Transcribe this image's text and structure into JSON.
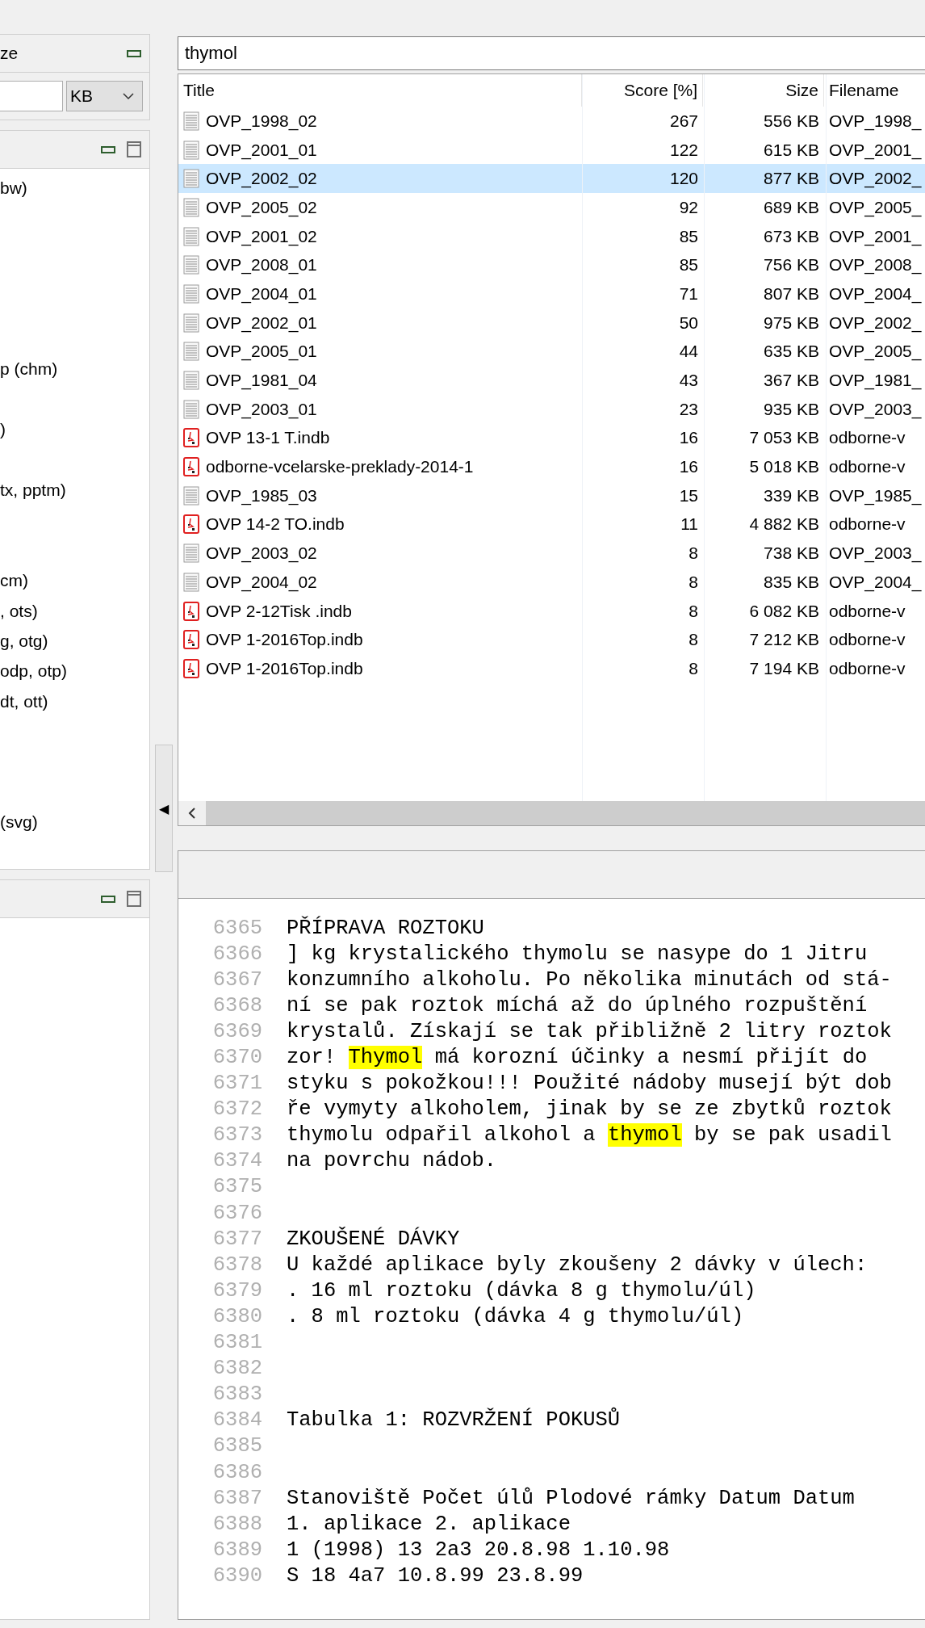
{
  "left_panels": [
    {
      "title": "ze",
      "controls": [
        {
          "kind": "minimize"
        }
      ],
      "size_filter": {
        "unit": "KB"
      }
    },
    {
      "controls": [
        {
          "kind": "minimize"
        },
        {
          "kind": "maximize"
        }
      ],
      "items": [
        {
          "text": "bw)"
        },
        {
          "text": "p (chm)"
        },
        {
          "text": ")"
        },
        {
          "text": "tx, pptm)"
        },
        {
          "text": "cm)"
        },
        {
          "text": ", ots)"
        },
        {
          "text": "g, otg)"
        },
        {
          "text": "odp, otp)"
        },
        {
          "text": "dt, ott)"
        },
        {
          "text": "(svg)"
        }
      ]
    },
    {
      "controls": [
        {
          "kind": "minimize"
        },
        {
          "kind": "maximize"
        }
      ]
    }
  ],
  "splitter": {
    "arrow": "◀"
  },
  "search": {
    "value": "thymol"
  },
  "results": {
    "columns": [
      "Title",
      "Score [%]",
      "Size",
      "Filename"
    ],
    "rows": [
      {
        "kind": "text",
        "title": "OVP_1998_02",
        "score": "267",
        "size": "556 KB",
        "filename": "OVP_1998_",
        "selected": false
      },
      {
        "kind": "text",
        "title": "OVP_2001_01",
        "score": "122",
        "size": "615 KB",
        "filename": "OVP_2001_",
        "selected": false
      },
      {
        "kind": "text",
        "title": "OVP_2002_02",
        "score": "120",
        "size": "877 KB",
        "filename": "OVP_2002_",
        "selected": true
      },
      {
        "kind": "text",
        "title": "OVP_2005_02",
        "score": "92",
        "size": "689 KB",
        "filename": "OVP_2005_",
        "selected": false
      },
      {
        "kind": "text",
        "title": "OVP_2001_02",
        "score": "85",
        "size": "673 KB",
        "filename": "OVP_2001_",
        "selected": false
      },
      {
        "kind": "text",
        "title": "OVP_2008_01",
        "score": "85",
        "size": "756 KB",
        "filename": "OVP_2008_",
        "selected": false
      },
      {
        "kind": "text",
        "title": "OVP_2004_01",
        "score": "71",
        "size": "807 KB",
        "filename": "OVP_2004_",
        "selected": false
      },
      {
        "kind": "text",
        "title": "OVP_2002_01",
        "score": "50",
        "size": "975 KB",
        "filename": "OVP_2002_",
        "selected": false
      },
      {
        "kind": "text",
        "title": "OVP_2005_01",
        "score": "44",
        "size": "635 KB",
        "filename": "OVP_2005_",
        "selected": false
      },
      {
        "kind": "text",
        "title": "OVP_1981_04",
        "score": "43",
        "size": "367 KB",
        "filename": "OVP_1981_",
        "selected": false
      },
      {
        "kind": "text",
        "title": "OVP_2003_01",
        "score": "23",
        "size": "935 KB",
        "filename": "OVP_2003_",
        "selected": false
      },
      {
        "kind": "pdf",
        "title": "OVP 13-1 T.indb",
        "score": "16",
        "size": "7 053 KB",
        "filename": "odborne-v",
        "selected": false
      },
      {
        "kind": "pdf",
        "title": "odborne-vcelarske-preklady-2014-1",
        "score": "16",
        "size": "5 018 KB",
        "filename": "odborne-v",
        "selected": false
      },
      {
        "kind": "text",
        "title": "OVP_1985_03",
        "score": "15",
        "size": "339 KB",
        "filename": "OVP_1985_",
        "selected": false
      },
      {
        "kind": "pdf",
        "title": "OVP 14-2 TO.indb",
        "score": "11",
        "size": "4 882 KB",
        "filename": "odborne-v",
        "selected": false
      },
      {
        "kind": "text",
        "title": "OVP_2003_02",
        "score": "8",
        "size": "738 KB",
        "filename": "OVP_2003_",
        "selected": false
      },
      {
        "kind": "text",
        "title": "OVP_2004_02",
        "score": "8",
        "size": "835 KB",
        "filename": "OVP_2004_",
        "selected": false
      },
      {
        "kind": "pdf",
        "title": "OVP 2-12Tisk .indb",
        "score": "8",
        "size": "6 082 KB",
        "filename": "odborne-v",
        "selected": false
      },
      {
        "kind": "pdf",
        "title": "OVP 1-2016Top.indb",
        "score": "8",
        "size": "7 212 KB",
        "filename": "odborne-v",
        "selected": false
      },
      {
        "kind": "pdf",
        "title": "OVP 1-2016Top.indb",
        "score": "8",
        "size": "7 194 KB",
        "filename": "odborne-v",
        "selected": false
      }
    ]
  },
  "preview": {
    "lines": [
      {
        "number": "6365",
        "parts": [
          {
            "text": "PŘÍPRAVA ROZTOKU",
            "highlighted": false
          }
        ]
      },
      {
        "number": "6366",
        "parts": [
          {
            "text": "] kg krystalického thymolu se nasype do 1 Jitru",
            "highlighted": false
          }
        ]
      },
      {
        "number": "6367",
        "parts": [
          {
            "text": "konzumního alkoholu. Po několika minutách od stá-",
            "highlighted": false
          }
        ]
      },
      {
        "number": "6368",
        "parts": [
          {
            "text": "ní se pak roztok míchá až do úplného rozpuštění",
            "highlighted": false
          }
        ]
      },
      {
        "number": "6369",
        "parts": [
          {
            "text": "krystalů. Získají se tak přibližně 2 litry roztok",
            "highlighted": false
          }
        ]
      },
      {
        "number": "6370",
        "parts": [
          {
            "text": "zor! ",
            "highlighted": false
          },
          {
            "text": "Thymol",
            "highlighted": true
          },
          {
            "text": " má korozní účinky a nesmí přijít do",
            "highlighted": false
          }
        ]
      },
      {
        "number": "6371",
        "parts": [
          {
            "text": "styku s pokožkou!!! Použité nádoby musejí být dob",
            "highlighted": false
          }
        ]
      },
      {
        "number": "6372",
        "parts": [
          {
            "text": "ře vymyty alkoholem, jinak by se ze zbytků roztok",
            "highlighted": false
          }
        ]
      },
      {
        "number": "6373",
        "parts": [
          {
            "text": "thymolu odpařil alkohol a ",
            "highlighted": false
          },
          {
            "text": "thymol",
            "highlighted": true
          },
          {
            "text": " by se pak usadil",
            "highlighted": false
          }
        ]
      },
      {
        "number": "6374",
        "parts": [
          {
            "text": "na povrchu nádob.",
            "highlighted": false
          }
        ]
      },
      {
        "number": "6375"
      },
      {
        "number": "6376"
      },
      {
        "number": "6377",
        "parts": [
          {
            "text": "ZKOUŠENÉ DÁVKY",
            "highlighted": false
          }
        ]
      },
      {
        "number": "6378",
        "parts": [
          {
            "text": "U každé aplikace byly zkoušeny 2 dávky v úlech:",
            "highlighted": false
          }
        ]
      },
      {
        "number": "6379",
        "parts": [
          {
            "text": ". 16 ml roztoku (dávka 8 g thymolu/úl)",
            "highlighted": false
          }
        ]
      },
      {
        "number": "6380",
        "parts": [
          {
            "text": ". 8 ml roztoku (dávka 4 g thymolu/úl)",
            "highlighted": false
          }
        ]
      },
      {
        "number": "6381"
      },
      {
        "number": "6382"
      },
      {
        "number": "6383"
      },
      {
        "number": "6384",
        "parts": [
          {
            "text": "Tabulka 1: ROZVRŽENÍ POKUSŮ",
            "highlighted": false
          }
        ]
      },
      {
        "number": "6385"
      },
      {
        "number": "6386"
      },
      {
        "number": "6387",
        "parts": [
          {
            "text": "Stanoviště Počet úlů Plodové rámky Datum Datum",
            "highlighted": false
          }
        ]
      },
      {
        "number": "6388",
        "parts": [
          {
            "text": "1. aplikace 2. aplikace",
            "highlighted": false
          }
        ]
      },
      {
        "number": "6389",
        "parts": [
          {
            "text": "1 (1998) 13 2a3 20.8.98 1.10.98",
            "highlighted": false
          }
        ]
      },
      {
        "number": "6390",
        "parts": [
          {
            "text": "S 18 4a7 10.8.99 23.8.99",
            "highlighted": false
          }
        ]
      }
    ]
  }
}
